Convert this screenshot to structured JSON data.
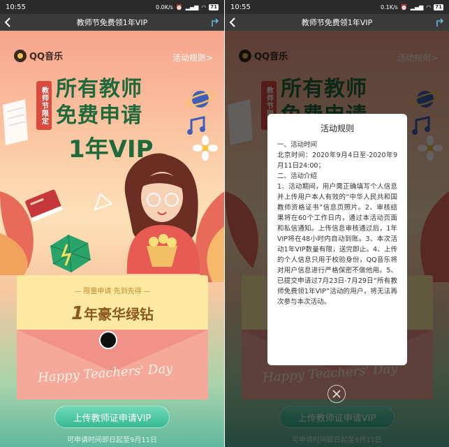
{
  "status_left": {
    "time": "10:55",
    "speed": "0.0K/s",
    "battery": "71"
  },
  "status_right": {
    "time": "10:55",
    "speed": "0.1K/s",
    "battery": "71"
  },
  "window": {
    "title": "教师节免费领1年VIP"
  },
  "brand": {
    "logo_text": "QQ音乐"
  },
  "header": {
    "rules_link": "活动规则>"
  },
  "poster": {
    "tag": "教师节限定",
    "headline_line1": "所有教师",
    "headline_line2": "免费申请",
    "vip_line": "1年VIP"
  },
  "card": {
    "subtitle": "— 限量申请 先到先得 —",
    "prize_number": "1",
    "prize_text": "年豪华绿钻",
    "script": "Happy Teachers' Day"
  },
  "cta": {
    "label": "上传教师证申请VIP"
  },
  "deadline": "可申请时间即日起至9月11日",
  "modal": {
    "title": "活动规则",
    "body": "一、活动时间\n北京时间：2020年9月4日至-2020年9月11日24:00；\n二、活动介绍\n1、活动期间，用户需正确填写个人信息并上传用户本人有效的“中华人民共和国教师资格证书”信息页照片。2、审核结果将在60个工作日内，通过本活动页面和私信通知。上传信息审核通过后，1年VIP将在48小时内自动到账。3、本次活动1年VIP数量有限，送完即止。4、上传的个人信息只用于校验身份，QQ音乐将对用户信息进行严格保密不做他用。5、已提交申请过7月23日-7月29日“所有教师免费领1年VIP”活动的用户，将无法再次参与本次活动。"
  },
  "colors": {
    "accent_green": "#36b893",
    "headline_green": "#1f6a3a",
    "tag_red": "#d94b3f"
  }
}
